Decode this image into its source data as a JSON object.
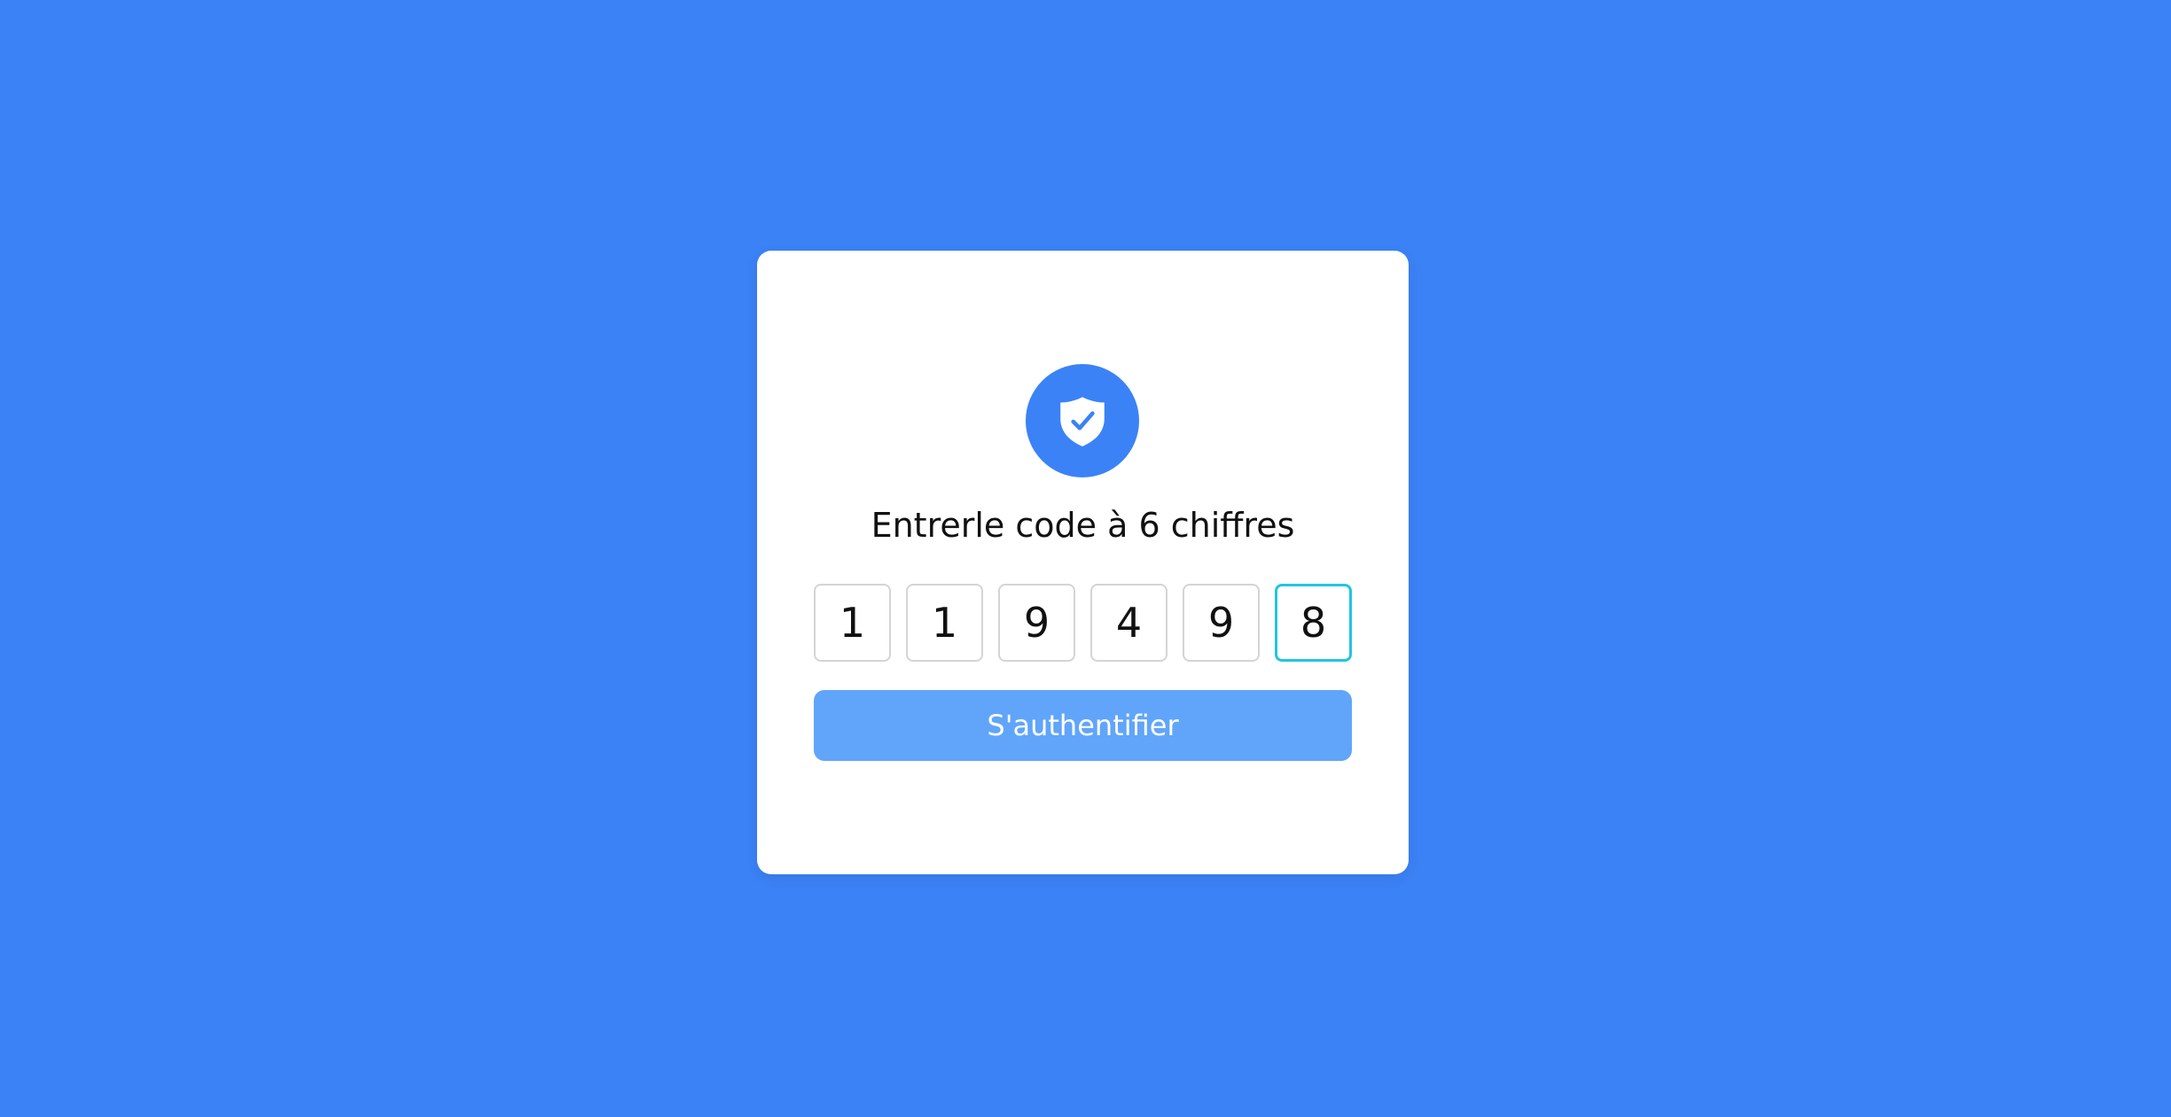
{
  "colors": {
    "background": "#3b82f6",
    "card": "#ffffff",
    "button": "#60a5fa",
    "active_border": "#22c5e0"
  },
  "icon": "shield-check-icon",
  "title": "Entrerle code à 6 chiffres",
  "code_digits": [
    "1",
    "1",
    "9",
    "4",
    "9",
    "8"
  ],
  "active_digit_index": 5,
  "submit_label": "S'authentifier"
}
